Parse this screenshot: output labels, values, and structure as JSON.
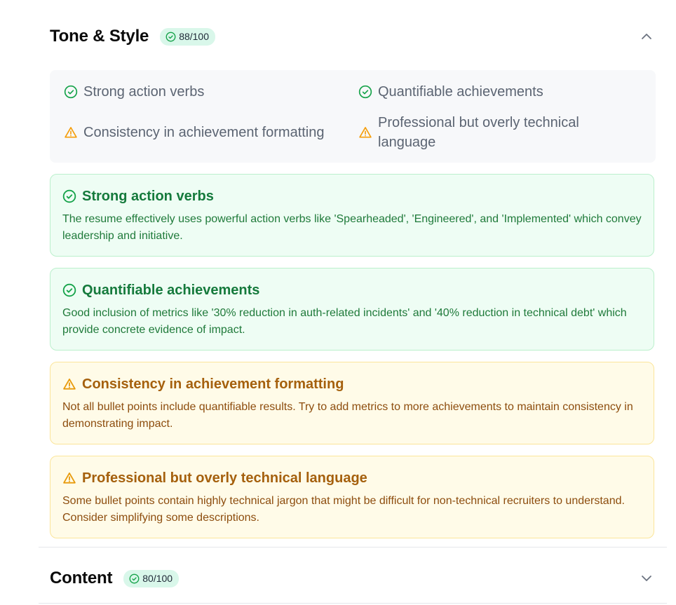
{
  "sections": [
    {
      "title": "Tone & Style",
      "score": "88/100",
      "expanded": true,
      "summary": [
        {
          "status": "success",
          "icon": "check-circle-icon",
          "label": "Strong action verbs"
        },
        {
          "status": "success",
          "icon": "check-circle-icon",
          "label": "Quantifiable achievements"
        },
        {
          "status": "warning",
          "icon": "warning-triangle-icon",
          "label": "Consistency in achievement formatting"
        },
        {
          "status": "warning",
          "icon": "warning-triangle-icon",
          "label": "Professional but overly technical language"
        }
      ],
      "cards": [
        {
          "status": "success",
          "icon": "check-circle-icon",
          "title": "Strong action verbs",
          "body": "The resume effectively uses powerful action verbs like 'Spearheaded', 'Engineered', and 'Implemented' which convey leadership and initiative."
        },
        {
          "status": "success",
          "icon": "check-circle-icon",
          "title": "Quantifiable achievements",
          "body": "Good inclusion of metrics like '30% reduction in auth-related incidents' and '40% reduction in technical debt' which provide concrete evidence of impact."
        },
        {
          "status": "warning",
          "icon": "warning-triangle-icon",
          "title": "Consistency in achievement formatting",
          "body": "Not all bullet points include quantifiable results. Try to add metrics to more achievements to maintain consistency in demonstrating impact."
        },
        {
          "status": "warning",
          "icon": "warning-triangle-icon",
          "title": "Professional but overly technical language",
          "body": "Some bullet points contain highly technical jargon that might be difficult for non-technical recruiters to understand. Consider simplifying some descriptions."
        }
      ]
    },
    {
      "title": "Content",
      "score": "80/100",
      "expanded": false
    }
  ],
  "colors": {
    "success": "#16a34a",
    "warning": "#f59e0b",
    "badge_bg": "#d9f7ea"
  }
}
